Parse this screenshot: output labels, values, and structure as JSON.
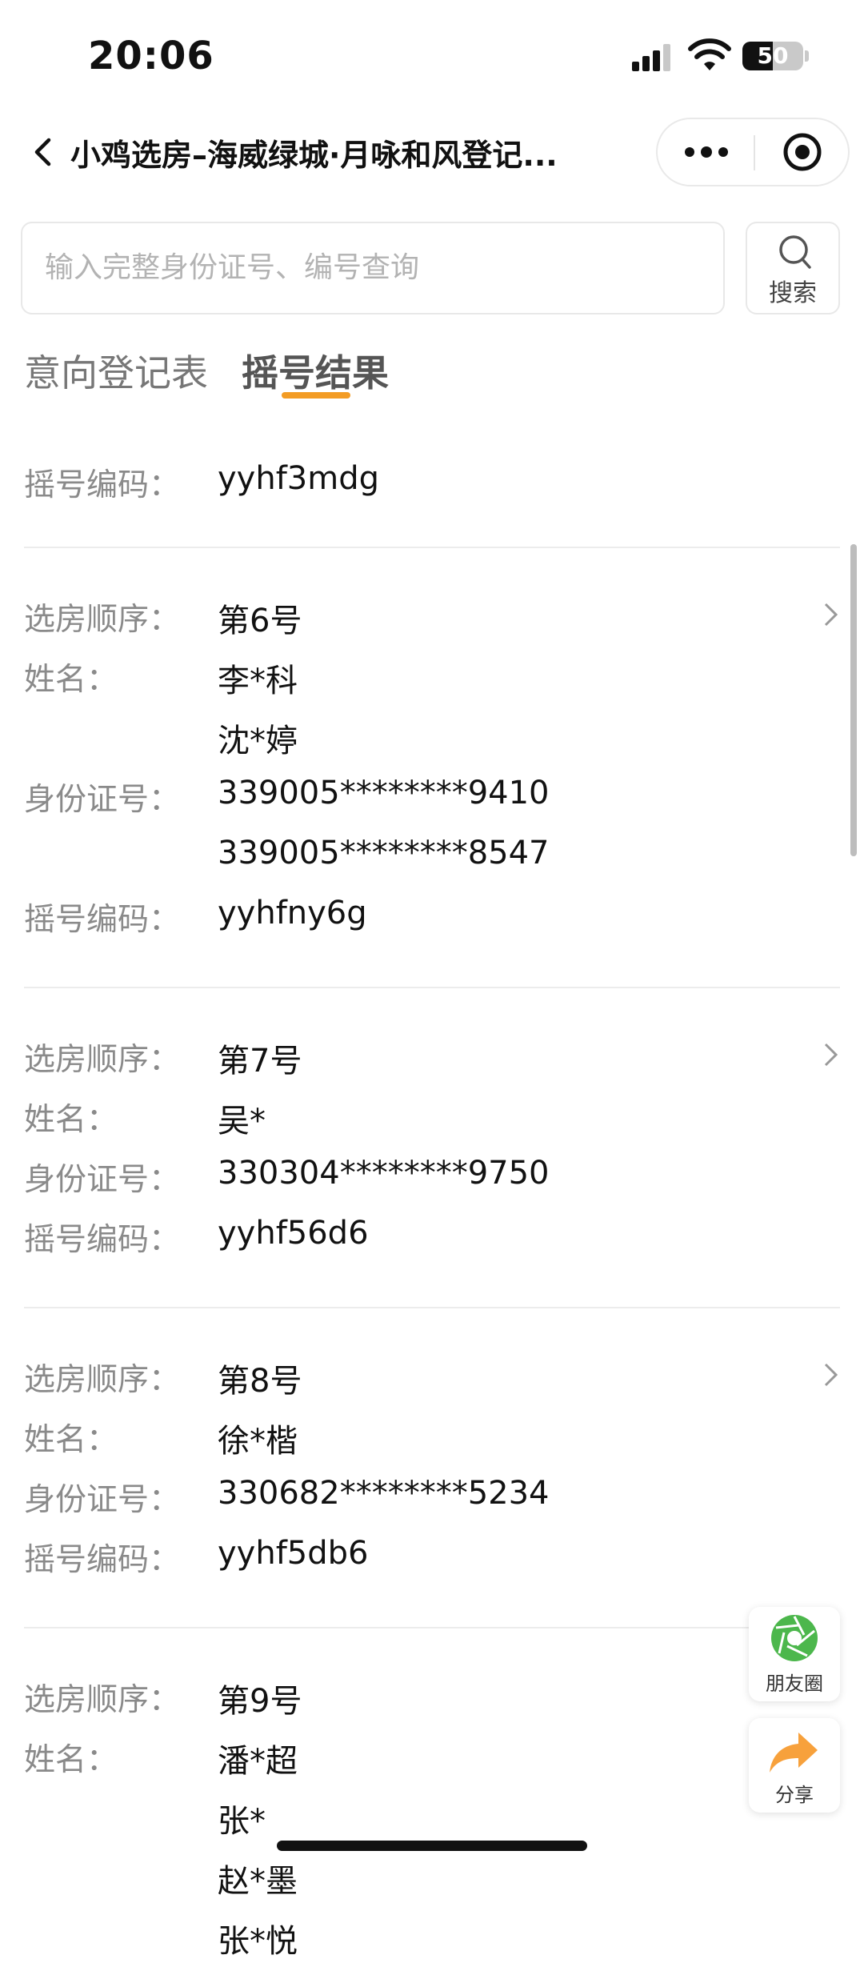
{
  "status_bar": {
    "time": "20:06",
    "battery": "50",
    "battery_level": 0.5
  },
  "nav": {
    "title": "小鸡选房–海威绿城·月咏和风登记..."
  },
  "search": {
    "placeholder": "输入完整身份证号、编号查询",
    "button_label": "搜索"
  },
  "tabs": [
    {
      "label": "意向登记表",
      "active": false
    },
    {
      "label": "摇号结果",
      "active": true
    }
  ],
  "labels": {
    "order": "选房顺序：",
    "name": "姓名：",
    "id": "身份证号：",
    "code": "摇号编码："
  },
  "records": [
    {
      "code": "yyhf3mdg"
    },
    {
      "order": "第6号",
      "names": [
        "李*科",
        "沈*婷"
      ],
      "ids": [
        "339005********9410",
        "339005********8547"
      ],
      "code": "yyhfny6g"
    },
    {
      "order": "第7号",
      "names": [
        "吴*"
      ],
      "ids": [
        "330304********9750"
      ],
      "code": "yyhf56d6"
    },
    {
      "order": "第8号",
      "names": [
        "徐*楷"
      ],
      "ids": [
        "330682********5234"
      ],
      "code": "yyhf5db6"
    },
    {
      "order": "第9号",
      "names": [
        "潘*超",
        "张*",
        "赵*墨",
        "张*悦"
      ]
    }
  ],
  "floating": {
    "moments_label": "朋友圈",
    "share_label": "分享"
  },
  "colors": {
    "accent": "#f39c24",
    "moments_green": "#4cb74c",
    "share_orange": "#f7a13c"
  }
}
